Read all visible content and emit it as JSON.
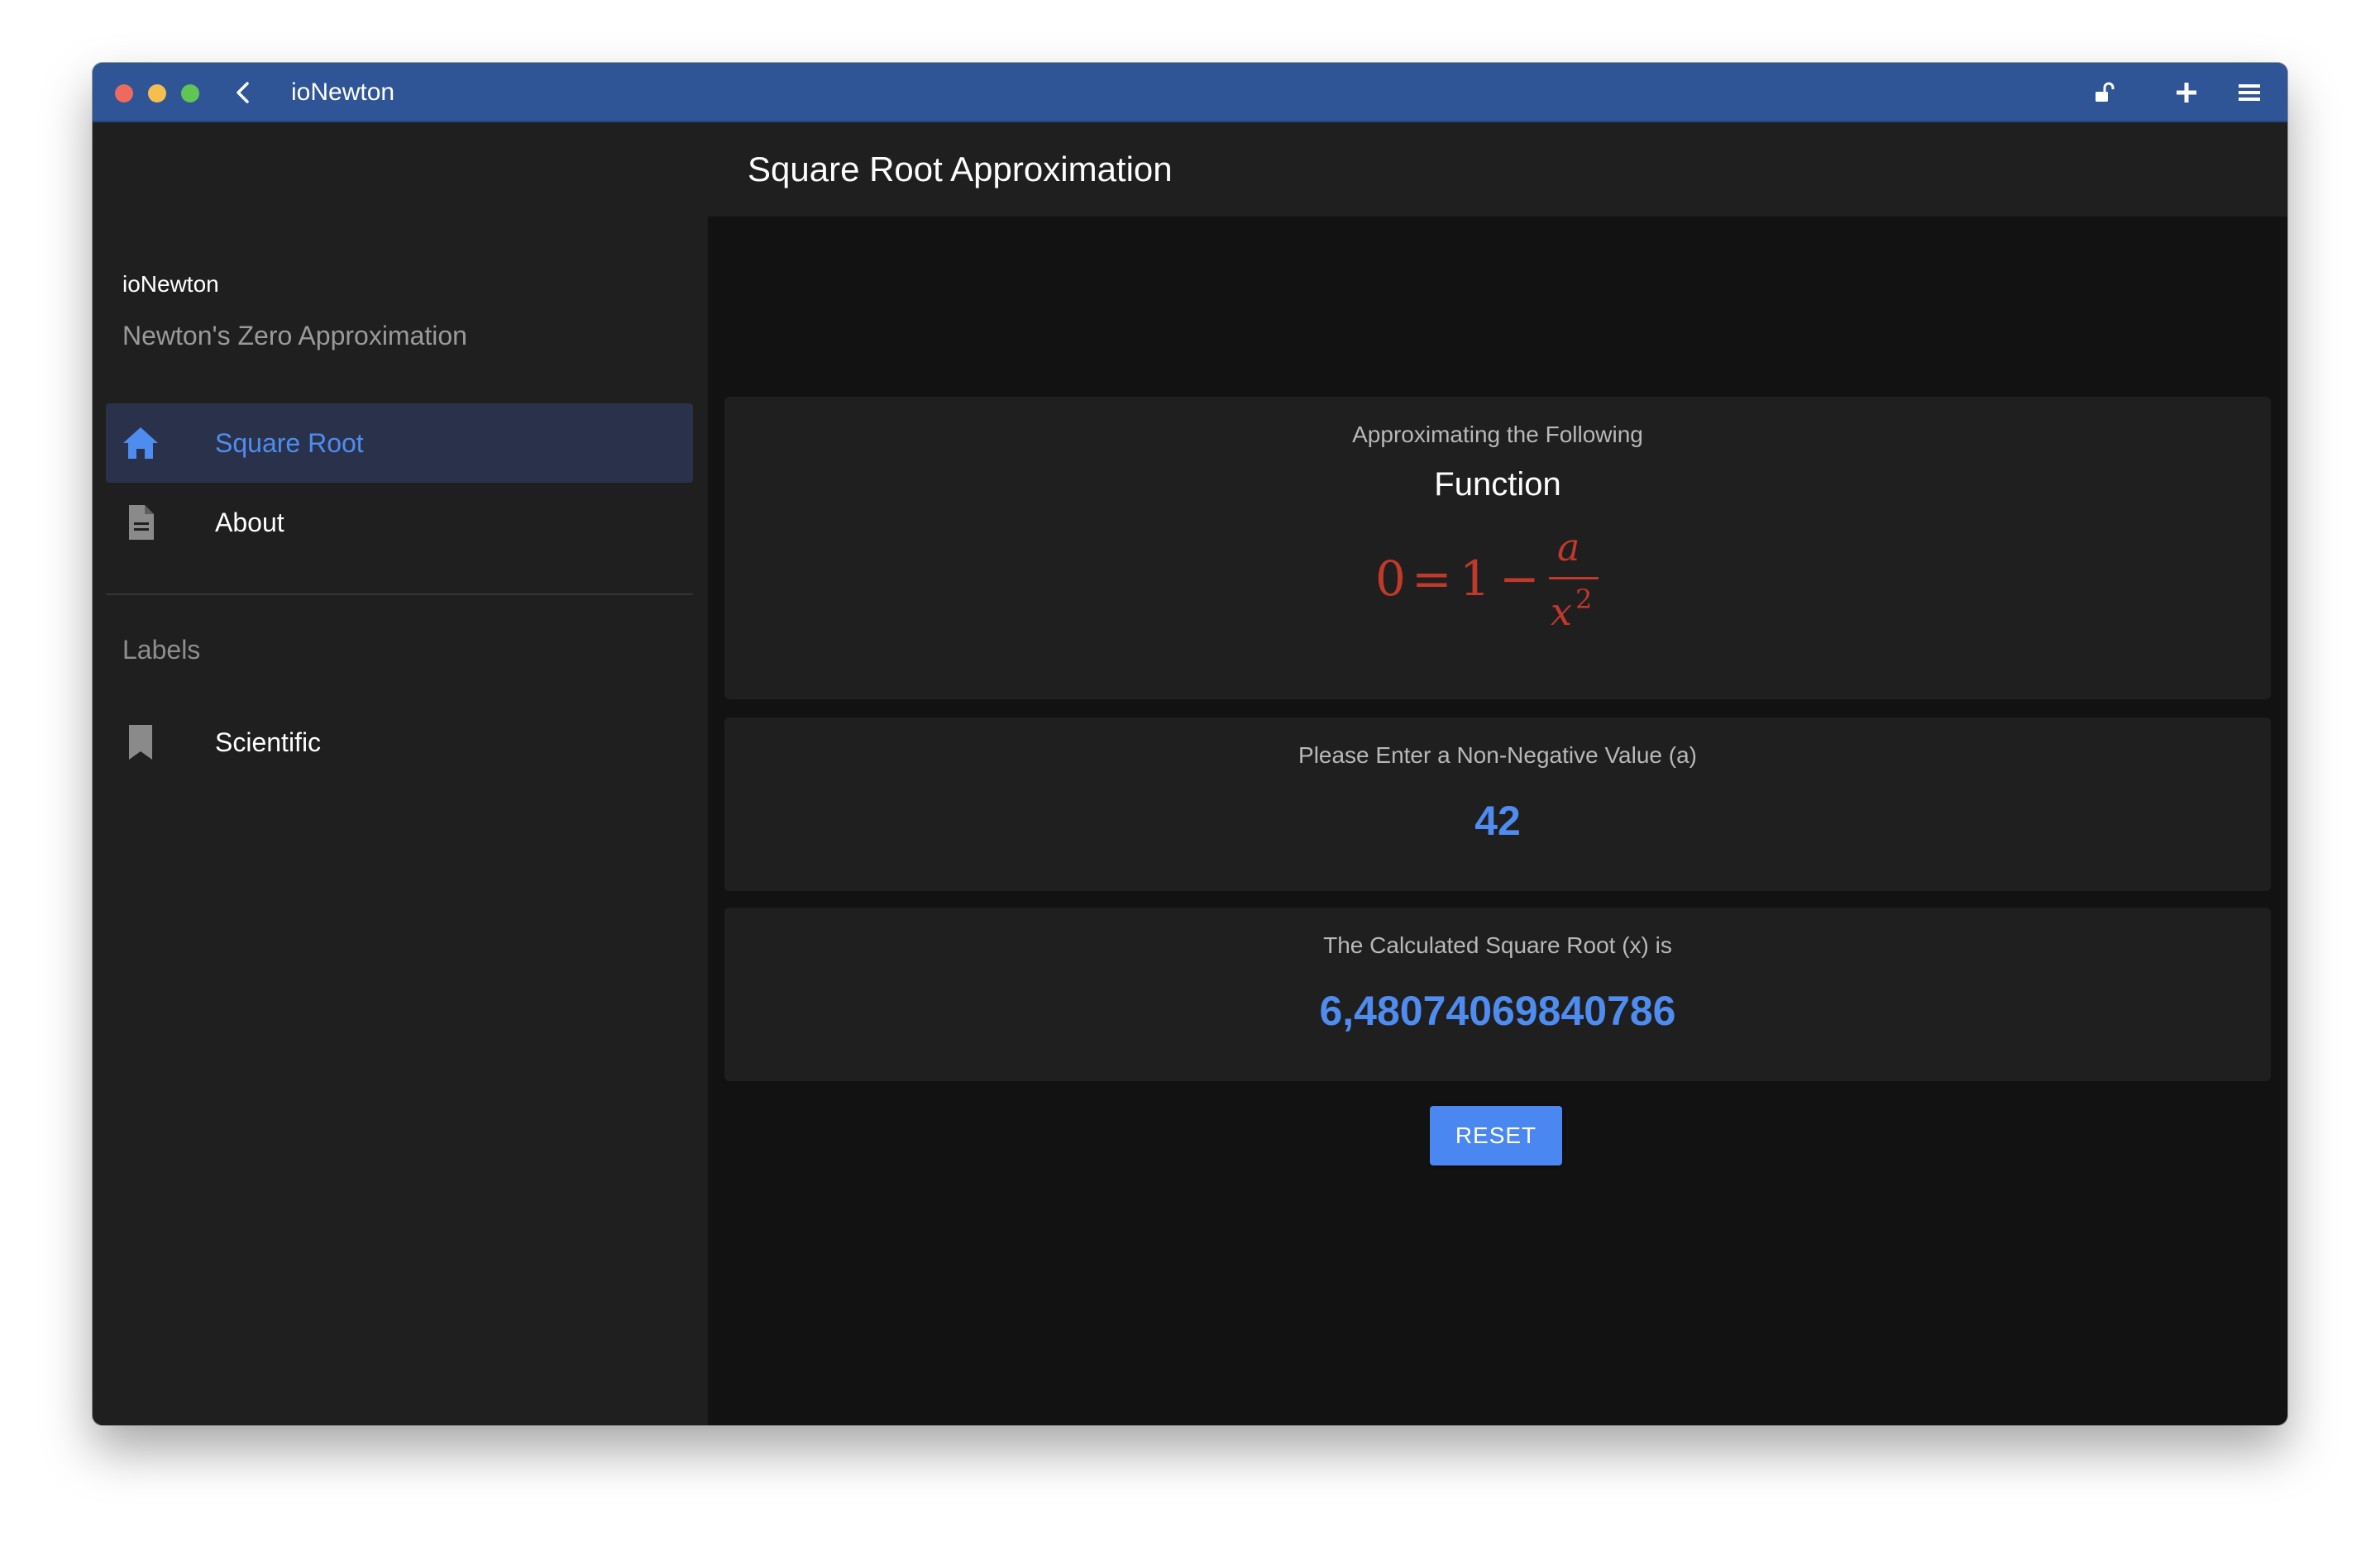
{
  "window": {
    "title": "ioNewton"
  },
  "titlebar_icons": [
    "back-chevron-icon",
    "unlock-icon",
    "plus-icon",
    "menu-icon"
  ],
  "sidebar": {
    "app_name": "ioNewton",
    "subtitle": "Newton's Zero Approximation",
    "items": [
      {
        "label": "Square Root",
        "icon": "home-icon",
        "active": true
      },
      {
        "label": "About",
        "icon": "document-icon",
        "active": false
      }
    ],
    "section_label": "Labels",
    "labels": [
      {
        "label": "Scientific",
        "icon": "bookmark-icon"
      }
    ]
  },
  "main": {
    "title": "Square Root Approximation",
    "function_card": {
      "caption": "Approximating the Following",
      "heading": "Function",
      "formula": {
        "lhs": "0",
        "equals": "=",
        "one": "1",
        "minus": "−",
        "numerator": "a",
        "denominator_base": "x",
        "denominator_exp": "2"
      }
    },
    "input_card": {
      "caption": "Please Enter a Non-Negative Value (a)",
      "value": "42"
    },
    "result_card": {
      "caption": "The Calculated Square Root (x) is",
      "value": "6,48074069840786"
    },
    "reset_label": "RESET"
  },
  "colors": {
    "titlebar": "#2f5596",
    "accent": "#4f8cf0",
    "formula": "#c0392b",
    "sidebar_bg": "#1f1f1f",
    "main_bg": "#121212"
  }
}
